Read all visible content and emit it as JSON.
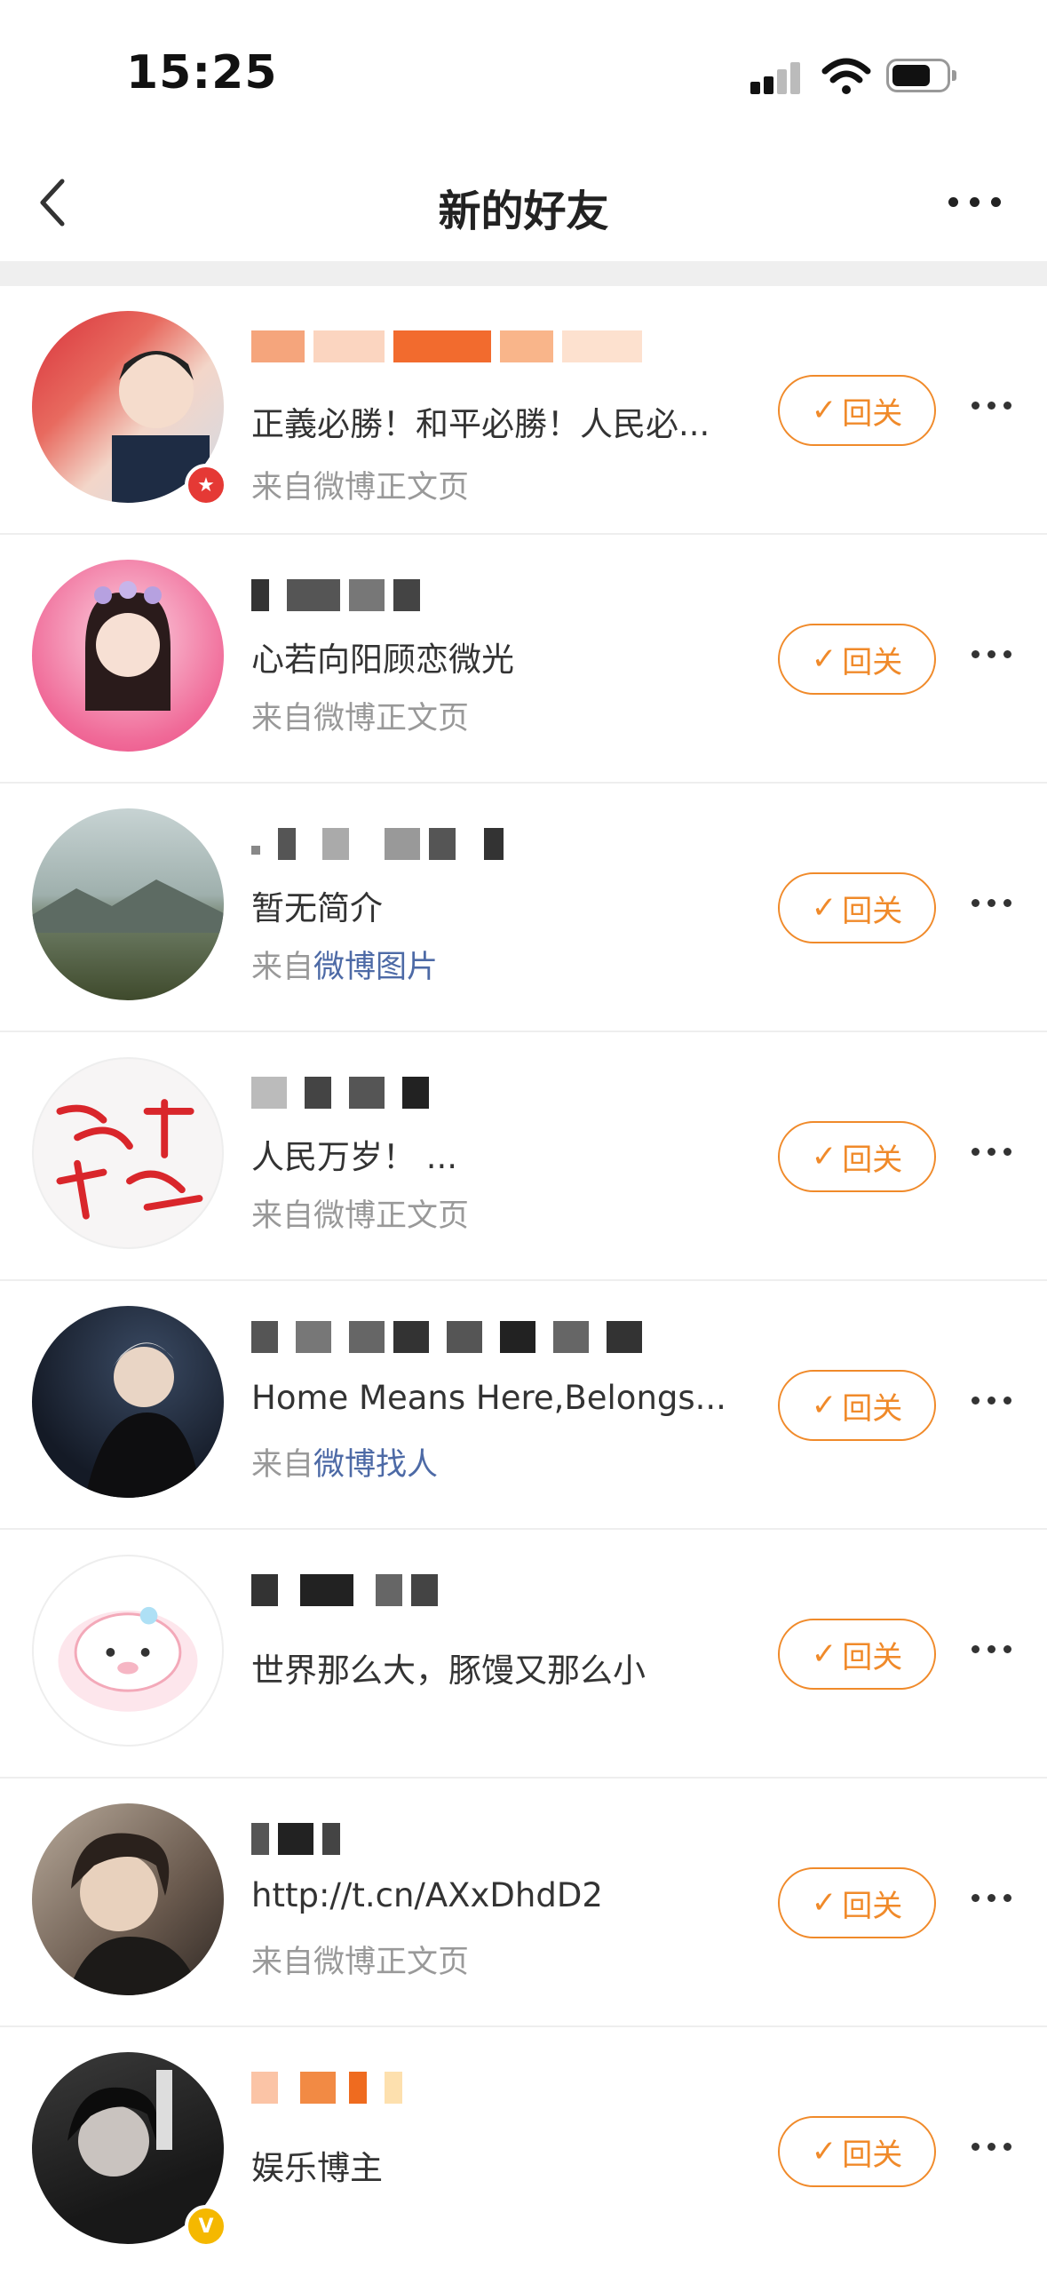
{
  "status_bar": {
    "time": "15:25"
  },
  "nav": {
    "title": "新的好友"
  },
  "colors": {
    "accent": "#f08a2a",
    "link": "#4d6aa6",
    "muted": "#999999"
  },
  "friends": [
    {
      "bio": "正義必勝！和平必勝！人民必...",
      "source_prefix": "来自",
      "source_link": "",
      "source_text": "微博正文页",
      "action": "回关",
      "badge": "red-star"
    },
    {
      "bio": "心若向阳顾恋微光",
      "source_prefix": "来自",
      "source_link": "",
      "source_text": "微博正文页",
      "action": "回关"
    },
    {
      "bio": "暂无简介",
      "source_prefix": "来自",
      "source_link": "微博图片",
      "source_text": "",
      "action": "回关"
    },
    {
      "bio": "人民万岁！ ...",
      "source_prefix": "来自",
      "source_link": "",
      "source_text": "微博正文页",
      "action": "回关"
    },
    {
      "bio": "Home Means Here,Belongs...",
      "source_prefix": "来自",
      "source_link": "微博找人",
      "source_text": "",
      "action": "回关"
    },
    {
      "bio": "世界那么大，豚馒又那么小",
      "source_prefix": "",
      "source_link": "",
      "source_text": "",
      "action": "回关"
    },
    {
      "bio": "http://t.cn/AXxDhdD2",
      "source_prefix": "来自",
      "source_link": "",
      "source_text": "微博正文页",
      "action": "回关"
    },
    {
      "bio": "娱乐博主",
      "source_prefix": "",
      "source_link": "",
      "source_text": "",
      "action": "回关",
      "badge": "yellow-v"
    }
  ],
  "badges": {
    "v": "V",
    "star": "★"
  },
  "icons": {
    "check": "✓"
  }
}
